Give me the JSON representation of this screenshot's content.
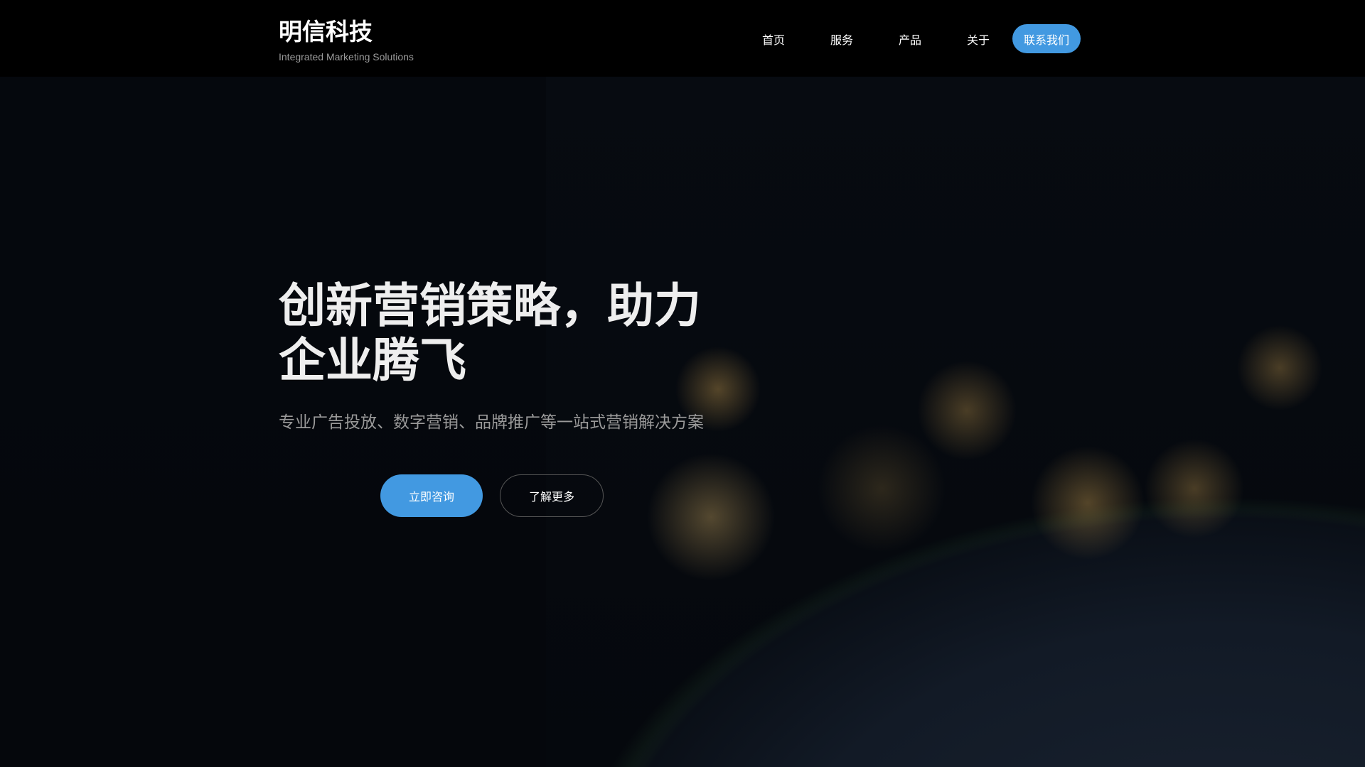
{
  "brand": {
    "name": "明信科技",
    "tagline": "Integrated Marketing Solutions"
  },
  "nav": {
    "items": [
      "首页",
      "服务",
      "产品",
      "关于"
    ],
    "contact": "联系我们"
  },
  "hero": {
    "title": "创新营销策略，助力企业腾飞",
    "subtitle": "专业广告投放、数字营销、品牌推广等一站式营销解决方案",
    "primary_button": "立即咨询",
    "secondary_button": "了解更多"
  }
}
